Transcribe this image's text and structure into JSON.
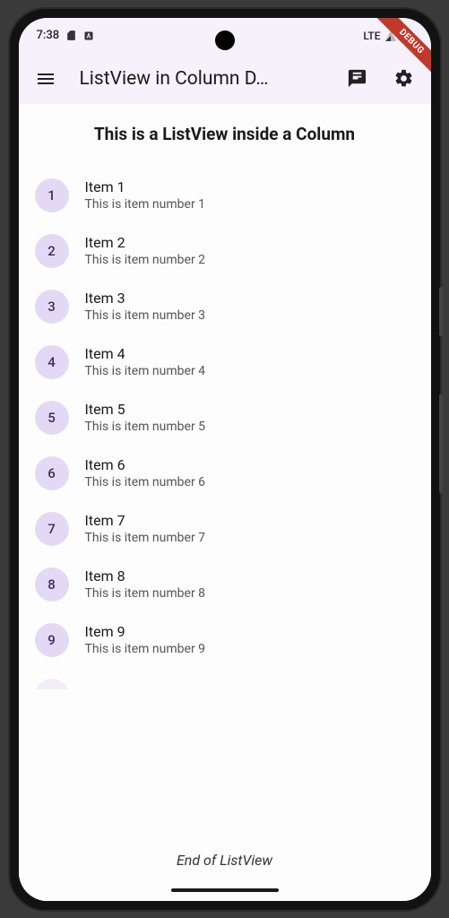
{
  "status_bar": {
    "time": "7:38",
    "network_label": "LTE"
  },
  "debug_banner": "DEBUG",
  "app_bar": {
    "title": "ListView in Column D…"
  },
  "heading": "This is a ListView inside a Column",
  "items": [
    {
      "index": "1",
      "title": "Item 1",
      "subtitle": "This is item number 1"
    },
    {
      "index": "2",
      "title": "Item 2",
      "subtitle": "This is item number 2"
    },
    {
      "index": "3",
      "title": "Item 3",
      "subtitle": "This is item number 3"
    },
    {
      "index": "4",
      "title": "Item 4",
      "subtitle": "This is item number 4"
    },
    {
      "index": "5",
      "title": "Item 5",
      "subtitle": "This is item number 5"
    },
    {
      "index": "6",
      "title": "Item 6",
      "subtitle": "This is item number 6"
    },
    {
      "index": "7",
      "title": "Item 7",
      "subtitle": "This is item number 7"
    },
    {
      "index": "8",
      "title": "Item 8",
      "subtitle": "This is item number 8"
    },
    {
      "index": "9",
      "title": "Item 9",
      "subtitle": "This is item number 9"
    }
  ],
  "footer": "End of ListView"
}
